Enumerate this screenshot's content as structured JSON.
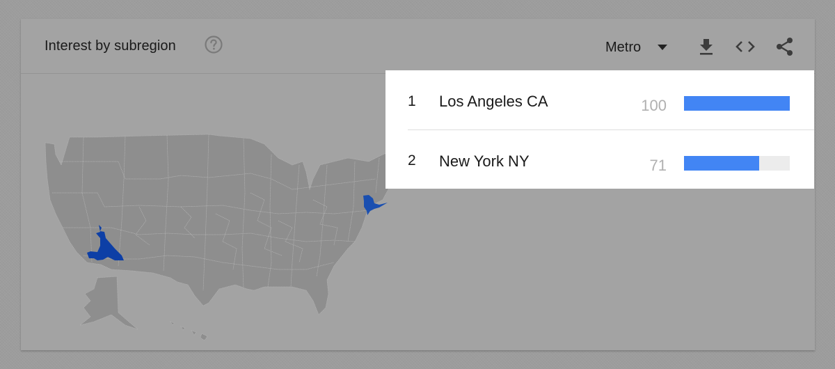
{
  "card": {
    "title": "Interest by subregion",
    "help_icon": "help-circle-icon"
  },
  "toolbar": {
    "resolution_selected": "Metro",
    "dropdown_icon": "caret-down-icon",
    "download_icon": "download-icon",
    "embed_icon": "embed-code-icon",
    "share_icon": "share-icon"
  },
  "map": {
    "region": "United States",
    "resolution": "metro",
    "highlighted_regions": [
      {
        "name": "Los Angeles CA",
        "color": "#0d3fa6"
      },
      {
        "name": "New York NY",
        "color": "#1a4fb0"
      }
    ],
    "base_color": "#8e8e8e",
    "border_color": "#b5b5b5"
  },
  "rankings": [
    {
      "rank": "1",
      "name": "Los Angeles CA",
      "value": "100",
      "fraction": 1.0
    },
    {
      "rank": "2",
      "name": "New York NY",
      "value": "71",
      "fraction": 0.71
    }
  ],
  "colors": {
    "bar_fill": "#4285f4",
    "bar_track": "#ececec",
    "overlay_background": "#a3a3a3",
    "panel_background": "#ffffff"
  }
}
